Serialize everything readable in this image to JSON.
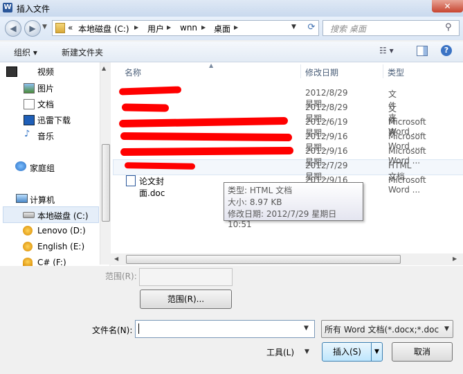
{
  "window": {
    "title": "插入文件",
    "app_icon": "W",
    "close_glyph": "✕"
  },
  "nav": {
    "back_glyph": "◀",
    "forward_glyph": "▶",
    "breadcrumb_overflow": "«",
    "breadcrumb": [
      "本地磁盘 (C:)",
      "用户",
      "wnn",
      "桌面"
    ],
    "separator": "▶",
    "search_placeholder": "搜索 桌面"
  },
  "toolbar": {
    "organize_label": "组织 ▾",
    "new_folder_label": "新建文件夹",
    "view_glyph": "☷ ▾",
    "help_glyph": "?"
  },
  "navpane": {
    "favorites": [
      "视频",
      "图片",
      "文档",
      "迅雷下载",
      "音乐"
    ],
    "homegroup": "家庭组",
    "computer": "计算机",
    "drives": [
      "本地磁盘 (C:)",
      "Lenovo (D:)",
      "English (E:)",
      "C# (F:)"
    ]
  },
  "columns": {
    "name": "名称",
    "modified": "修改日期",
    "type": "类型"
  },
  "files": [
    {
      "name": "",
      "modified": "2012/8/29 星期...",
      "type": "文件夹"
    },
    {
      "name": "",
      "modified": "2012/8/29 星期...",
      "type": "文件夹"
    },
    {
      "name": "",
      "modified": "2012/6/19 星期...",
      "type": "Microsoft Word ..."
    },
    {
      "name": "",
      "modified": "2012/9/16 星期...",
      "type": "Microsoft Word ..."
    },
    {
      "name": "",
      "modified": "2012/9/16 星期...",
      "type": "Microsoft Word ..."
    },
    {
      "name": "",
      "modified": "2012/7/29 星期...",
      "type": "HTML 文档"
    },
    {
      "name": "论文封面.doc",
      "modified": "2012/9/16 星期...",
      "type": "Microsoft Word ..."
    }
  ],
  "tooltip": {
    "line1": "类型: HTML 文档",
    "line2": "大小: 8.97 KB",
    "line3": "修改日期: 2012/7/29 星期日 10:51"
  },
  "form": {
    "range_label": "范围(R):",
    "range_button": "范围(R)...",
    "filename_label": "文件名(N):",
    "filename_value": "",
    "filetype_value": "所有 Word 文档(*.docx;*.doc",
    "tools_label": "工具(L)",
    "insert_label": "插入(S)",
    "cancel_label": "取消"
  },
  "colors": {
    "accent": "#2b579a",
    "selection": "#e5eef9",
    "redaction": "#ff0000"
  }
}
